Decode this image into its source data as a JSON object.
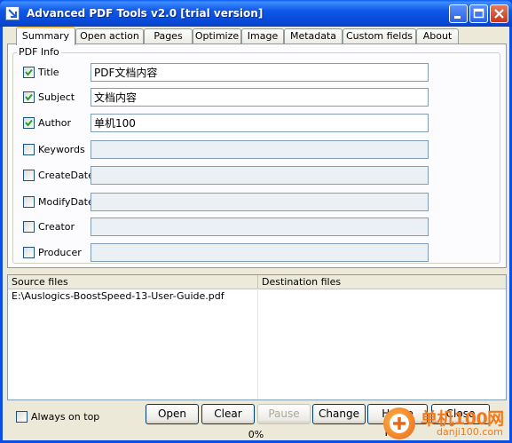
{
  "window": {
    "title": "Advanced PDF Tools  v2.0 [trial version]",
    "icons": {
      "app": "app-logo-icon",
      "minimize": "minimize-icon",
      "maximize": "maximize-icon",
      "close": "close-icon"
    }
  },
  "tabs": [
    {
      "label": "Summary",
      "active": true
    },
    {
      "label": "Open action"
    },
    {
      "label": "Pages"
    },
    {
      "label": "Optimize"
    },
    {
      "label": "Image"
    },
    {
      "label": "Metadata"
    },
    {
      "label": "Custom fields"
    },
    {
      "label": "About"
    }
  ],
  "pdf_info": {
    "group_label": "PDF Info",
    "fields": [
      {
        "label": "Title",
        "checked": true,
        "value": "PDF文档内容"
      },
      {
        "label": "Subject",
        "checked": true,
        "value": "文档内容"
      },
      {
        "label": "Author",
        "checked": true,
        "value": "单机100"
      },
      {
        "label": "Keywords",
        "checked": false,
        "value": ""
      },
      {
        "label": "CreateDate",
        "checked": false,
        "value": ""
      },
      {
        "label": "ModifyDate",
        "checked": false,
        "value": ""
      },
      {
        "label": "Creator",
        "checked": false,
        "value": ""
      },
      {
        "label": "Producer",
        "checked": false,
        "value": ""
      }
    ]
  },
  "files": {
    "columns": [
      "Source files",
      "Destination files"
    ],
    "rows": [
      [
        "E:\\Auslogics-BoostSpeed-13-User-Guide.pdf",
        ""
      ]
    ]
  },
  "bottom": {
    "always_on_top": {
      "label": "Always on top",
      "checked": false
    },
    "buttons": [
      {
        "label": "Open",
        "enabled": true
      },
      {
        "label": "Clear",
        "enabled": true
      },
      {
        "label": "Pause",
        "enabled": false
      },
      {
        "label": "Change",
        "enabled": true
      },
      {
        "label": "Home Page",
        "enabled": true
      },
      {
        "label": "Close",
        "enabled": true
      }
    ],
    "progress": "0%"
  },
  "watermark": {
    "line1": "单机100网",
    "line2": "danji100.com",
    "logo": "plus-logo-icon"
  },
  "colors": {
    "titlebar": "#0a4ee4",
    "face": "#ece9d8",
    "tab_active_accent": "#ffc83c",
    "watermark": "#f07a1a"
  }
}
